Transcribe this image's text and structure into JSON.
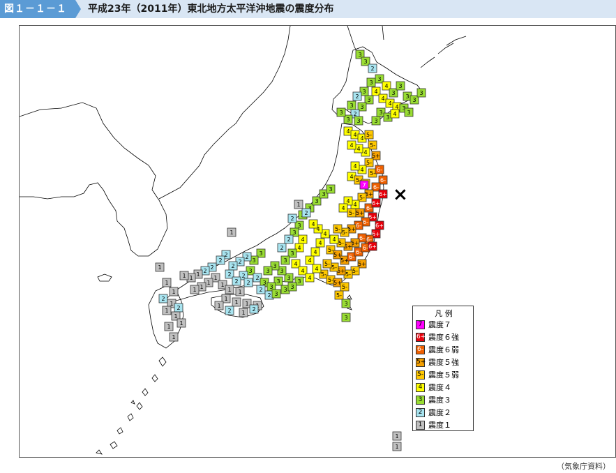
{
  "header": {
    "figure_label": "図１－１－１",
    "title": "平成23年（2011年）東北地方太平洋沖地震の震度分布",
    "tab_color": "#5b9bd5",
    "bar_color": "#d9e6f4"
  },
  "legend": {
    "title": "凡 例",
    "items": [
      {
        "code": "7",
        "label": "震度７",
        "color": "#ff00ff"
      },
      {
        "code": "6+",
        "label": "震度６強",
        "color": "#e8000b"
      },
      {
        "code": "6-",
        "label": "震度６弱",
        "color": "#f06000"
      },
      {
        "code": "5+",
        "label": "震度５強",
        "color": "#f5a000"
      },
      {
        "code": "5-",
        "label": "震度５弱",
        "color": "#ffc800"
      },
      {
        "code": "4",
        "label": "震度４",
        "color": "#ffff00"
      },
      {
        "code": "3",
        "label": "震度３",
        "color": "#99dd33"
      },
      {
        "code": "2",
        "label": "震度２",
        "color": "#a8e4f0"
      },
      {
        "code": "1",
        "label": "震度１",
        "color": "#c0c0c0"
      }
    ]
  },
  "source": "（気象庁資料）",
  "epicenter_symbol": "×",
  "colors": {
    "coast": "#000000",
    "sea": "#ffffff"
  }
}
